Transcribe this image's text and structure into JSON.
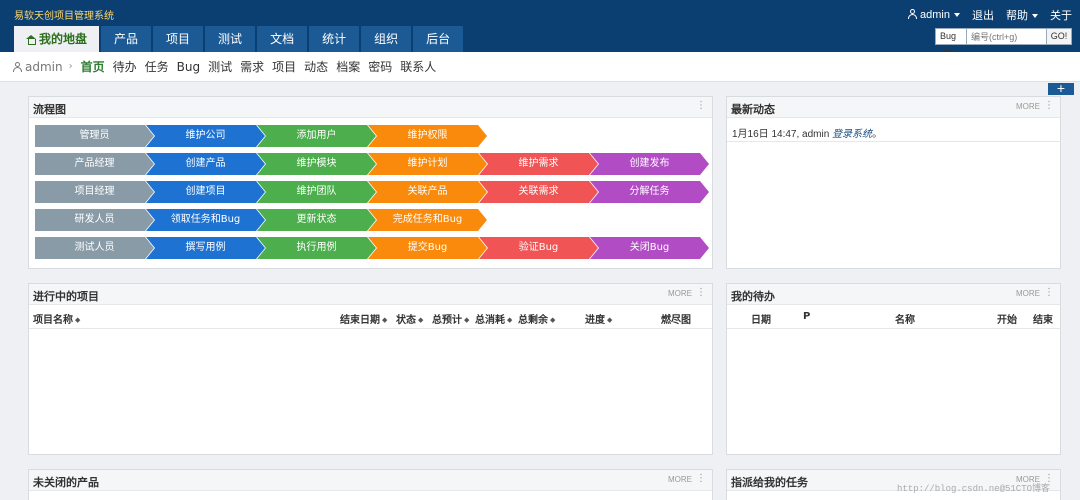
{
  "app": {
    "title": "易软天创项目管理系统"
  },
  "user_menu": {
    "user": "admin",
    "logout": "退出",
    "help": "帮助",
    "about": "关于"
  },
  "main_nav": [
    "我的地盘",
    "产品",
    "项目",
    "测试",
    "文档",
    "统计",
    "组织",
    "后台"
  ],
  "search": {
    "type": "Bug",
    "placeholder": "编号(ctrl+g)",
    "go": "GO!"
  },
  "subnav": {
    "crumb": "admin",
    "items": [
      "首页",
      "待办",
      "任务",
      "Bug",
      "测试",
      "需求",
      "项目",
      "动态",
      "档案",
      "密码",
      "联系人"
    ]
  },
  "panels": {
    "flow": {
      "title": "流程图"
    },
    "dynamics": {
      "title": "最新动态",
      "more": "MORE",
      "entry_time": "1月16日 14:47, admin",
      "entry_action": "登录系统",
      "entry_end": "。"
    },
    "projects": {
      "title": "进行中的项目",
      "more": "MORE",
      "columns": [
        "项目名称",
        "结束日期",
        "状态",
        "总预计",
        "总消耗",
        "总剩余",
        "进度",
        "燃尽图"
      ]
    },
    "todo": {
      "title": "我的待办",
      "more": "MORE",
      "columns": [
        "日期",
        "P",
        "名称",
        "开始",
        "结束"
      ]
    },
    "products": {
      "title": "未关闭的产品",
      "more": "MORE"
    },
    "tasks": {
      "title": "指派给我的任务",
      "more": "MORE"
    }
  },
  "flowchart": [
    [
      "管理员",
      "维护公司",
      "添加用户",
      "维护权限"
    ],
    [
      "产品经理",
      "创建产品",
      "维护模块",
      "维护计划",
      "维护需求",
      "创建发布"
    ],
    [
      "项目经理",
      "创建项目",
      "维护团队",
      "关联产品",
      "关联需求",
      "分解任务"
    ],
    [
      "研发人员",
      "领取任务和Bug",
      "更新状态",
      "完成任务和Bug"
    ],
    [
      "测试人员",
      "撰写用例",
      "执行用例",
      "提交Bug",
      "验证Bug",
      "关闭Bug"
    ]
  ],
  "flow_colors": [
    "#8a9ba8",
    "#1e73d2",
    "#4cae4c",
    "#f98a0b",
    "#f05454",
    "#b14cc4"
  ],
  "watermark": "http://blog.csdn.ne@51CTO博客"
}
